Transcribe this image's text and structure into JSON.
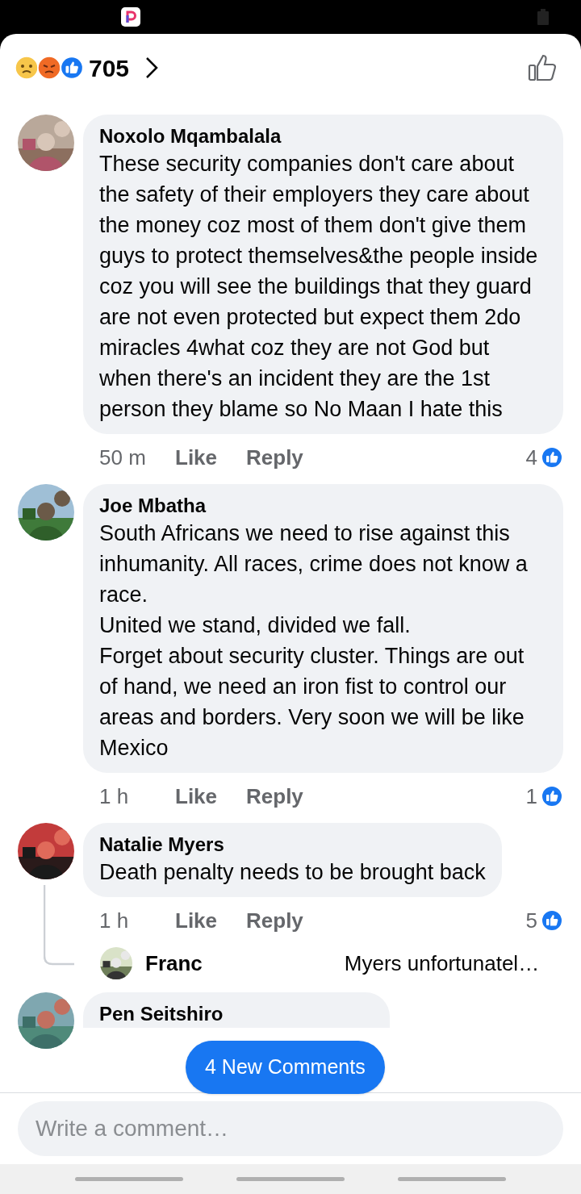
{
  "reactions": {
    "count": "705"
  },
  "comments": [
    {
      "author": "Noxolo Mqambalala",
      "text": "These security companies don't care about the safety of their employers they care about the money coz most of them don't give them guys to protect themselves&the people inside coz you will see the buildings that they guard are not even protected but expect them 2do miracles 4what coz they are not God but when there's an incident they are the 1st person they blame so No Maan I hate this",
      "time": "50 m",
      "like": "Like",
      "reply": "Reply",
      "like_count": "4"
    },
    {
      "author": "Joe Mbatha",
      "text": "South Africans we need to rise against this inhumanity. All races, crime does not know a race.\nUnited we stand, divided we fall.\nForget about security cluster. Things are out of hand, we need an iron fist to control our areas and borders. Very soon we will be like Mexico",
      "time": "1 h",
      "like": "Like",
      "reply": "Reply",
      "like_count": "1"
    },
    {
      "author": "Natalie Myers",
      "text": "Death penalty needs to be brought back",
      "time": "1 h",
      "like": "Like",
      "reply": "Reply",
      "like_count": "5",
      "replies": [
        {
          "author": "Franc",
          "text": "Myers unfortunatel…"
        }
      ]
    },
    {
      "author": "Pen Seitshiro"
    }
  ],
  "new_comments_button": "4 New Comments",
  "composer": {
    "placeholder": "Write a comment…"
  }
}
